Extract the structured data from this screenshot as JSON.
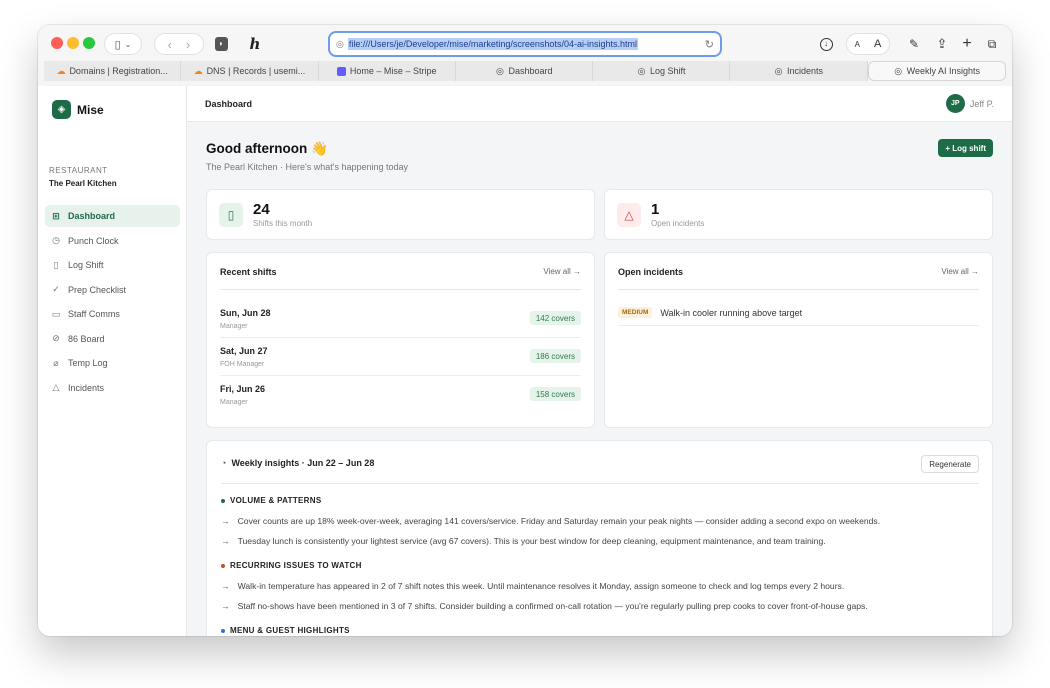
{
  "browser": {
    "url": "file:///Users/je/Developer/mise/marketing/screenshots/04-ai-insights.html",
    "tabs": [
      {
        "label": "Domains | Registration...",
        "icon": "cloudflare-icon"
      },
      {
        "label": "DNS | Records | usemi...",
        "icon": "cloudflare-icon"
      },
      {
        "label": "Home – Mise – Stripe",
        "icon": "stripe-icon"
      },
      {
        "label": "Dashboard",
        "icon": "compass-icon"
      },
      {
        "label": "Log Shift",
        "icon": "compass-icon"
      },
      {
        "label": "Incidents",
        "icon": "compass-icon"
      },
      {
        "label": "Weekly AI Insights",
        "icon": "compass-icon",
        "active": true
      }
    ]
  },
  "sidebar": {
    "brand": "Mise",
    "restaurant_label": "RESTAURANT",
    "restaurant_name": "The Pearl Kitchen",
    "items": [
      {
        "label": "Dashboard",
        "icon": "grid-icon",
        "active": true
      },
      {
        "label": "Punch Clock",
        "icon": "clock-icon"
      },
      {
        "label": "Log Shift",
        "icon": "document-icon"
      },
      {
        "label": "Prep Checklist",
        "icon": "check-icon"
      },
      {
        "label": "Staff Comms",
        "icon": "chat-icon"
      },
      {
        "label": "86 Board",
        "icon": "ban-icon"
      },
      {
        "label": "Temp Log",
        "icon": "thermometer-icon"
      },
      {
        "label": "Incidents",
        "icon": "warning-icon"
      }
    ]
  },
  "header": {
    "title": "Dashboard",
    "user_initials": "JP",
    "user_name": "Jeff P."
  },
  "main": {
    "greeting": "Good afternoon 👋",
    "subtitle": "The Pearl Kitchen · Here's what's happening today",
    "log_shift_button": "+ Log shift",
    "stats": [
      {
        "value": "24",
        "label": "Shifts this month",
        "icon": "document-icon"
      },
      {
        "value": "1",
        "label": "Open incidents",
        "icon": "warning-icon"
      }
    ],
    "recent_shifts": {
      "title": "Recent shifts",
      "view_all": "View all →",
      "rows": [
        {
          "date": "Sun, Jun 28",
          "role": "Manager",
          "covers": "142 covers"
        },
        {
          "date": "Sat, Jun 27",
          "role": "FOH Manager",
          "covers": "186 covers"
        },
        {
          "date": "Fri, Jun 26",
          "role": "Manager",
          "covers": "158 covers"
        }
      ]
    },
    "open_incidents": {
      "title": "Open incidents",
      "view_all": "View all →",
      "rows": [
        {
          "severity": "MEDIUM",
          "text": "Walk-in cooler running above target"
        }
      ]
    },
    "insights": {
      "title": "Weekly insights · Jun 22 – Jun 28",
      "regenerate": "Regenerate",
      "sections": [
        {
          "heading": "VOLUME & PATTERNS",
          "color": "#1e6b48",
          "lines": [
            "Cover counts are up 18% week-over-week, averaging 141 covers/service. Friday and Saturday remain your peak nights — consider adding a second expo on weekends.",
            "Tuesday lunch is consistently your lightest service (avg 67 covers). This is your best window for deep cleaning, equipment maintenance, and team training."
          ]
        },
        {
          "heading": "RECURRING ISSUES TO WATCH",
          "color": "#c0531f",
          "lines": [
            "Walk-in temperature has appeared in 2 of 7 shift notes this week. Until maintenance resolves it Monday, assign someone to check and log temps every 2 hours.",
            "Staff no-shows have been mentioned in 3 of 7 shifts. Consider building a confirmed on-call rotation — you're regularly pulling prep cooks to cover front-of-house gaps."
          ]
        },
        {
          "heading": "MENU & GUEST HIGHLIGHTS",
          "color": "#2f6fd6",
          "lines": []
        }
      ]
    }
  }
}
